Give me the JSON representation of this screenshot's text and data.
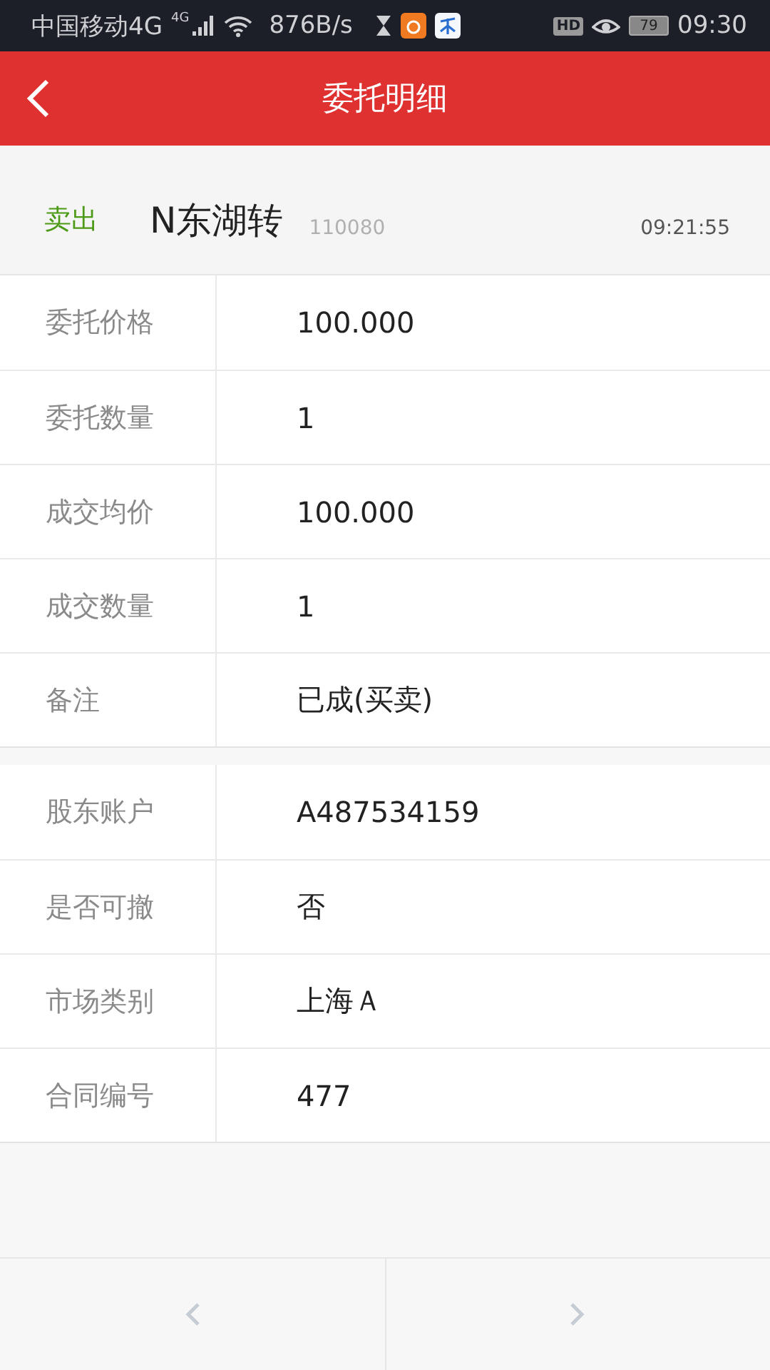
{
  "status_bar": {
    "carrier": "中国移动4G",
    "network_badge": "4G",
    "speed": "876B/s",
    "hd_badge": "HD",
    "battery": "79",
    "time": "09:30"
  },
  "header": {
    "title": "委托明细"
  },
  "order": {
    "side": "卖出",
    "name": "N东湖转",
    "code": "110080",
    "time": "09:21:55"
  },
  "groups": [
    {
      "rows": [
        {
          "label": "委托价格",
          "value": "100.000"
        },
        {
          "label": "委托数量",
          "value": "1"
        },
        {
          "label": "成交均价",
          "value": "100.000"
        },
        {
          "label": "成交数量",
          "value": "1"
        },
        {
          "label": "备注",
          "value": "已成(买卖)"
        }
      ]
    },
    {
      "rows": [
        {
          "label": "股东账户",
          "value": "A487534159"
        },
        {
          "label": "是否可撤",
          "value": "否"
        },
        {
          "label": "市场类别",
          "value": "上海Ａ"
        },
        {
          "label": "合同编号",
          "value": "477"
        }
      ]
    }
  ]
}
